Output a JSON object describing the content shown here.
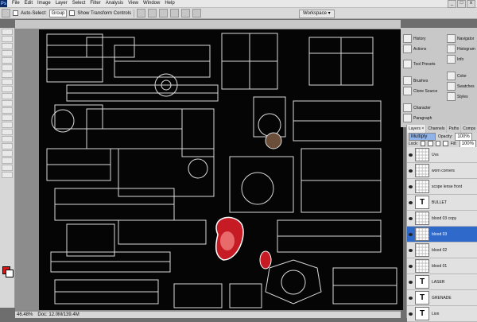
{
  "menu": [
    "File",
    "Edit",
    "Image",
    "Layer",
    "Select",
    "Filter",
    "Analysis",
    "View",
    "Window",
    "Help"
  ],
  "options": {
    "auto_select_label": "Auto-Select:",
    "group_value": "Group",
    "show_transform_label": "Show Transform Controls",
    "workspace_label": "Workspace ▾"
  },
  "window_buttons": [
    "_",
    "□",
    "x"
  ],
  "status": {
    "zoom": "46.48%",
    "doc": "Doc: 12.0M/139.4M"
  },
  "panels": {
    "history": "History",
    "actions": "Actions",
    "tool_presets": "Tool Presets",
    "brushes": "Brushes",
    "clone_source": "Clone Source",
    "character": "Character",
    "paragraph": "Paragraph",
    "navigator": "Navigator",
    "histogram": "Histogram",
    "info": "Info",
    "color": "Color",
    "swatches": "Swatches",
    "styles": "Styles"
  },
  "layers_panel": {
    "tabs": [
      "Layers ×",
      "Channels",
      "Paths",
      "Comps"
    ],
    "blend_mode": "Multiply",
    "opacity_label": "Opacity:",
    "opacity_value": "100%",
    "lock_label": "Lock:",
    "fill_label": "Fill:",
    "fill_value": "100%",
    "layers": [
      {
        "name": "Uvs",
        "type": "pixel"
      },
      {
        "name": "worn corners",
        "type": "pixel"
      },
      {
        "name": "scope lense front",
        "type": "pixel"
      },
      {
        "name": "BULLET",
        "type": "text"
      },
      {
        "name": "blood 03 copy",
        "type": "pixel"
      },
      {
        "name": "blood 03",
        "type": "pixel",
        "selected": true
      },
      {
        "name": "blood 02",
        "type": "pixel"
      },
      {
        "name": "blood 01",
        "type": "pixel"
      },
      {
        "name": "LASER",
        "type": "text"
      },
      {
        "name": "GRENADE",
        "type": "text"
      },
      {
        "name": "Lion",
        "type": "text"
      }
    ]
  },
  "colors": {
    "foreground": "#d01919",
    "background": "#ffffff",
    "selection": "#2f6acb"
  }
}
